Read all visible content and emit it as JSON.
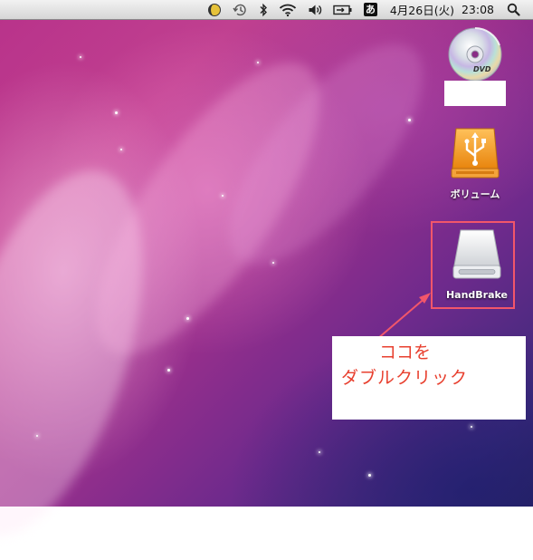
{
  "menubar": {
    "date": "4月26日(火)",
    "time": "23:08",
    "input_method": "あ",
    "icons": [
      "moon-icon",
      "time-machine-icon",
      "bluetooth-icon",
      "wifi-icon",
      "volume-icon",
      "battery-icon",
      "input-method-icon",
      "spotlight-icon"
    ]
  },
  "desktop": {
    "icons": [
      {
        "name": "dvd",
        "label": ""
      },
      {
        "name": "usb-volume",
        "label": "ボリューム"
      },
      {
        "name": "handbrake-disk",
        "label": "HandBrake"
      }
    ]
  },
  "annotation": {
    "line1": "ココを",
    "line2": "ダブルクリック",
    "color": "#e8402f"
  },
  "colors": {
    "highlight_border": "#f2566a",
    "usb_orange": "#f39c1f"
  }
}
